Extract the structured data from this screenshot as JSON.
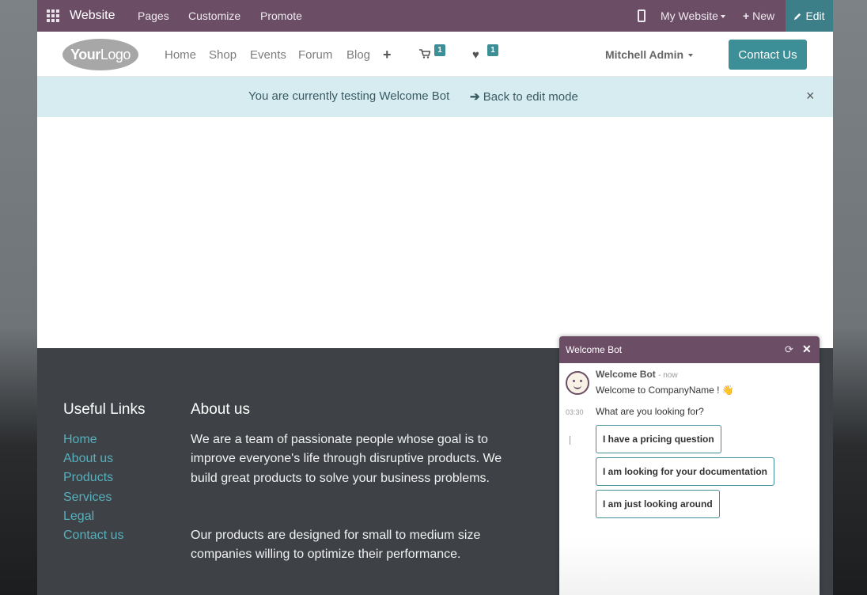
{
  "adminbar": {
    "brand": "Website",
    "menu": [
      "Pages",
      "Customize",
      "Promote"
    ],
    "website_selector": "My Website",
    "new_label": "New",
    "edit_label": "Edit",
    "icons": [
      "apps-grid-icon",
      "mobile-preview-icon",
      "plus-icon",
      "pencil-icon"
    ]
  },
  "navbar": {
    "logo": {
      "bold": "Your",
      "light": "Logo"
    },
    "links": [
      "Home",
      "Shop",
      "Events",
      "Forum",
      "Blog"
    ],
    "cart_count": "1",
    "wishlist_count": "1",
    "user": "Mitchell Admin",
    "contact_label": "Contact Us"
  },
  "banner": {
    "message": "You are currently testing Welcome Bot",
    "back_label": "Back to edit mode",
    "close": "×"
  },
  "footer": {
    "useful_links_title": "Useful Links",
    "useful_links": [
      "Home",
      "About us",
      "Products",
      "Services",
      "Legal",
      "Contact us"
    ],
    "about_title": "About us",
    "about_p1": "We are a team of passionate people whose goal is to improve everyone's life through disruptive products. We build great products to solve your business problems.",
    "about_p2": "Our products are designed for small to medium size companies willing to optimize their performance."
  },
  "chat": {
    "title": "Welcome Bot",
    "author": "Welcome Bot",
    "author_time": "now",
    "welcome": "Welcome to CompanyName ! 👋",
    "timestamp": "03:30",
    "question": "What are you looking for?",
    "options": [
      "I have a pricing question",
      "I am looking for your documentation",
      "I am just looking around"
    ]
  },
  "colors": {
    "admin_bar": "#6b4e66",
    "accent": "#3d8f97",
    "banner": "#d6ecf1",
    "footer": "#3e4247",
    "link": "#56b0bd"
  }
}
